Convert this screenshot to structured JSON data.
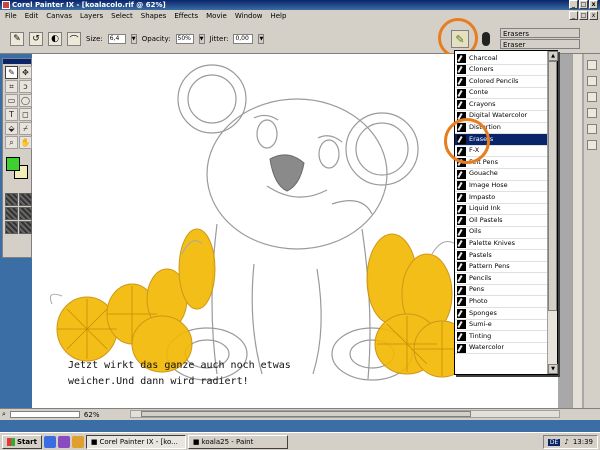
{
  "window": {
    "title": "Corel Painter IX - [koalacolo.rif @ 62%]",
    "buttons": [
      "_",
      "□",
      "x"
    ]
  },
  "menu": [
    "File",
    "Edit",
    "Canvas",
    "Layers",
    "Select",
    "Shapes",
    "Effects",
    "Movie",
    "Window",
    "Help"
  ],
  "propbar": {
    "size_label": "Size:",
    "size_value": "6,4",
    "opacity_label": "Opacity:",
    "opacity_value": "50%",
    "jitter_label": "Jitter:",
    "jitter_value": "0,00"
  },
  "brush_selector": {
    "category": "Erasers",
    "variant": "Eraser"
  },
  "brush_categories": [
    "Charcoal",
    "Cloners",
    "Colored Pencils",
    "Conte",
    "Crayons",
    "Digital Watercolor",
    "Distortion",
    "Erasers",
    "F-X",
    "Felt Pens",
    "Gouache",
    "Image Hose",
    "Impasto",
    "Liquid Ink",
    "Oil Pastels",
    "Oils",
    "Palette Knives",
    "Pastels",
    "Pattern Pens",
    "Pencils",
    "Pens",
    "Photo",
    "Sponges",
    "Sumi-e",
    "Tinting",
    "Watercolor"
  ],
  "selected_category": "Erasers",
  "caption": {
    "line1": "Jetzt wirkt das ganze auch noch etwas",
    "line2": "weicher.Und dann wird radiert!"
  },
  "status": {
    "zoom": "62%"
  },
  "taskbar": {
    "start": "Start",
    "tasks": [
      "Corel Painter IX - [ko...",
      "koala25 - Paint"
    ],
    "lang": "DE",
    "time": "13:39"
  },
  "colors": {
    "main_color": "#3cd030",
    "additional_color": "#f5edb8",
    "highlight_circle": "#e87d20",
    "orange_fill": "#f2b800"
  }
}
